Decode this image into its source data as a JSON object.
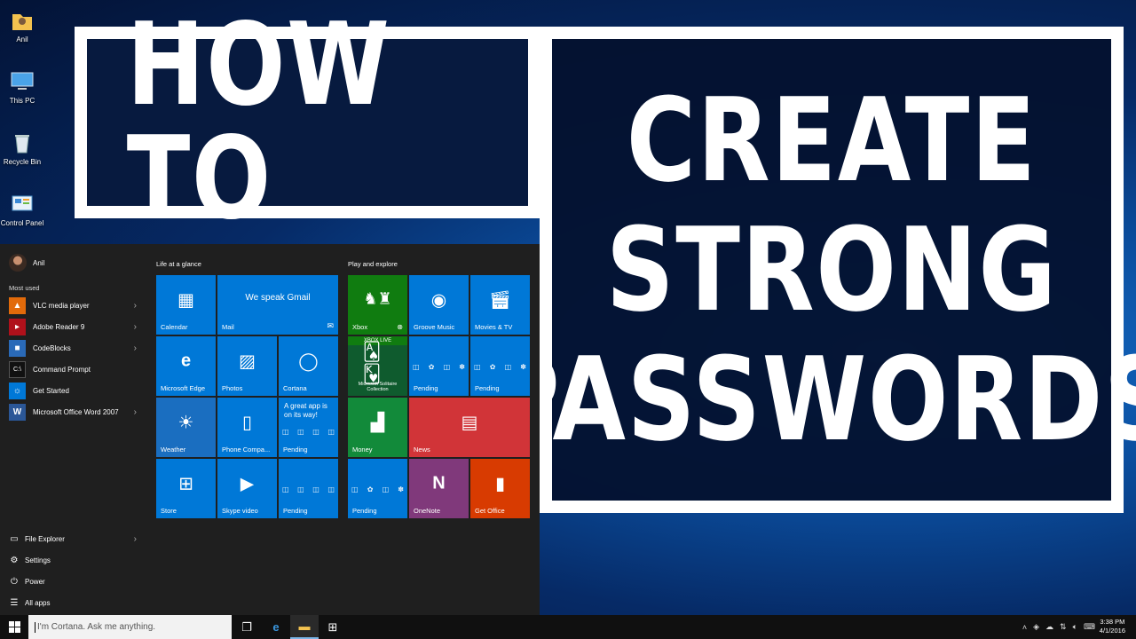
{
  "desktop": {
    "icons": [
      {
        "label": "Anil",
        "icon": "user-folder-icon"
      },
      {
        "label": "This PC",
        "icon": "computer-icon"
      },
      {
        "label": "Recycle Bin",
        "icon": "recycle-bin-icon"
      },
      {
        "label": "Control Panel",
        "icon": "control-panel-icon"
      }
    ]
  },
  "overlay": {
    "how_to": "HOW TO",
    "line1": "CREATE",
    "line2": "STRONG",
    "line3": "PASSWORDS"
  },
  "start_menu": {
    "user": "Anil",
    "most_used_heading": "Most used",
    "apps": [
      {
        "label": "VLC media player",
        "icon": "vlc-icon",
        "color": "#e26a0a",
        "has_arrow": true
      },
      {
        "label": "Adobe Reader 9",
        "icon": "adobe-reader-icon",
        "color": "#b0111b",
        "has_arrow": true
      },
      {
        "label": "CodeBlocks",
        "icon": "codeblocks-icon",
        "color": "#2a6ab8",
        "has_arrow": true
      },
      {
        "label": "Command Prompt",
        "icon": "command-prompt-icon",
        "color": "#111111",
        "has_arrow": false
      },
      {
        "label": "Get Started",
        "icon": "lightbulb-icon",
        "color": "#0078d7",
        "has_arrow": false
      },
      {
        "label": "Microsoft Office Word 2007",
        "icon": "word-icon",
        "color": "#2b5797",
        "has_arrow": true
      }
    ],
    "bottom": [
      {
        "label": "File Explorer",
        "icon": "folder-icon"
      },
      {
        "label": "Settings",
        "icon": "gear-icon"
      },
      {
        "label": "Power",
        "icon": "power-icon"
      },
      {
        "label": "All apps",
        "icon": "all-apps-icon"
      }
    ],
    "groups": {
      "life": "Life at a glance",
      "play": "Play and explore"
    },
    "tiles": {
      "calendar": "Calendar",
      "mail": "Mail",
      "mail_text": "We speak Gmail",
      "edge": "Microsoft Edge",
      "photos": "Photos",
      "cortana": "Cortana",
      "weather": "Weather",
      "phone": "Phone Compa...",
      "store_promo_text": "A great app is on its way!",
      "pending": "Pending",
      "store": "Store",
      "skype": "Skype video",
      "xbox": "Xbox",
      "xbox_live": "XBOX LIVE",
      "solitaire": "Microsoft Solitaire Collection",
      "groove": "Groove Music",
      "movies": "Movies & TV",
      "money": "Money",
      "news": "News",
      "onenote": "OneNote",
      "office": "Get Office"
    },
    "colors": {
      "tile_blue": "#0078d7",
      "xbox_green": "#107c10",
      "news_red": "#d13438",
      "onenote_purple": "#80397b",
      "office_orange": "#d83b01",
      "money_green": "#128a3a"
    }
  },
  "taskbar": {
    "search_placeholder": "I'm Cortana. Ask me anything.",
    "apps": [
      "task-view-icon",
      "edge-icon",
      "file-explorer-icon",
      "store-icon"
    ],
    "time": "3:38 PM",
    "date": "4/1/2016"
  }
}
